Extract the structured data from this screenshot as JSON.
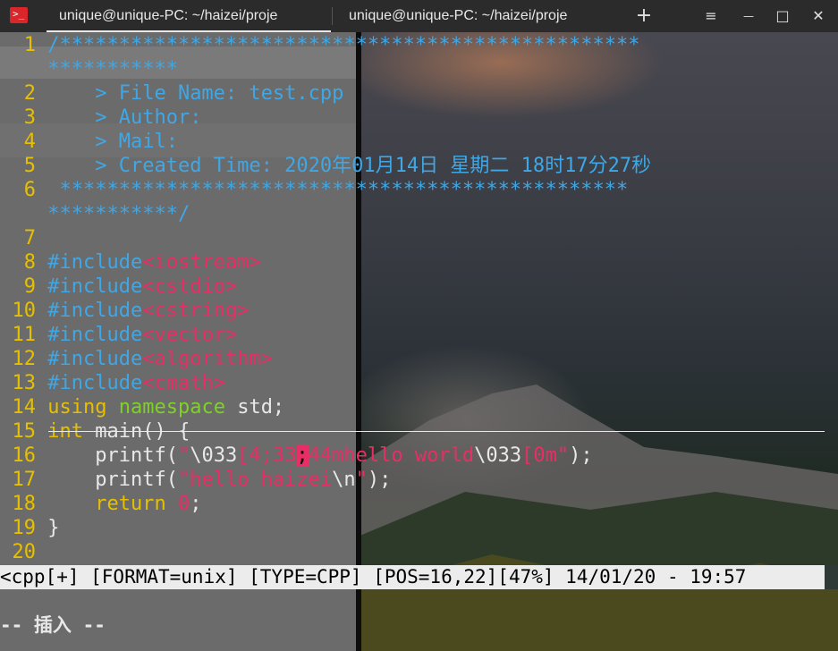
{
  "window": {
    "tabs": [
      {
        "label": "unique@unique-PC: ~/haizei/proje",
        "active": true
      },
      {
        "label": "unique@unique-PC: ~/haizei/proje",
        "active": false
      }
    ],
    "new_tab_glyph": "+",
    "menu_glyph": "≡",
    "minimize_glyph": "—",
    "maximize_glyph": "□",
    "close_glyph": "✕"
  },
  "editor": {
    "lines": [
      {
        "n": "1",
        "parts": [
          [
            "cmt",
            "/*************************************************"
          ]
        ]
      },
      {
        "n": "",
        "parts": [
          [
            "cmt",
            "***********"
          ]
        ]
      },
      {
        "n": "2",
        "parts": [
          [
            "cmt",
            "    > File Name: test.cpp"
          ]
        ]
      },
      {
        "n": "3",
        "parts": [
          [
            "cmt",
            "    > Author:"
          ]
        ]
      },
      {
        "n": "4",
        "parts": [
          [
            "cmt",
            "    > Mail:"
          ]
        ]
      },
      {
        "n": "5",
        "parts": [
          [
            "cmt",
            "    > Created Time: 2020年01月14日 星期二 18时17分27秒"
          ]
        ]
      },
      {
        "n": "6",
        "parts": [
          [
            "cmt",
            " ************************************************"
          ]
        ]
      },
      {
        "n": "",
        "parts": [
          [
            "cmt",
            "***********/"
          ]
        ]
      },
      {
        "n": "7",
        "parts": []
      },
      {
        "n": "8",
        "parts": [
          [
            "pp",
            "#include"
          ],
          [
            "hdr",
            "<iostream>"
          ]
        ]
      },
      {
        "n": "9",
        "parts": [
          [
            "pp",
            "#include"
          ],
          [
            "hdr",
            "<cstdio>"
          ]
        ]
      },
      {
        "n": "10",
        "parts": [
          [
            "pp",
            "#include"
          ],
          [
            "hdr",
            "<cstring>"
          ]
        ]
      },
      {
        "n": "11",
        "parts": [
          [
            "pp",
            "#include"
          ],
          [
            "hdr",
            "<vector>"
          ]
        ]
      },
      {
        "n": "12",
        "parts": [
          [
            "pp",
            "#include"
          ],
          [
            "hdr",
            "<algorithm>"
          ]
        ]
      },
      {
        "n": "13",
        "parts": [
          [
            "pp",
            "#include"
          ],
          [
            "hdr",
            "<cmath>"
          ]
        ]
      },
      {
        "n": "14",
        "parts": [
          [
            "kw2",
            "using"
          ],
          [
            "txt",
            " "
          ],
          [
            "kw",
            "namespace"
          ],
          [
            "txt",
            " std;"
          ]
        ]
      },
      {
        "n": "15",
        "parts": [
          [
            "kw2",
            "int"
          ],
          [
            "txt",
            " main() {"
          ]
        ]
      },
      {
        "n": "16",
        "parts": [
          [
            "txt",
            "    printf("
          ],
          [
            "str",
            "\""
          ],
          [
            "esc",
            "\\033"
          ],
          [
            "str",
            "[4;33"
          ],
          [
            "cursor",
            ";"
          ],
          [
            "str",
            "44mhello world"
          ],
          [
            "esc",
            "\\033"
          ],
          [
            "str",
            "[0m\""
          ],
          [
            "txt",
            ");"
          ]
        ]
      },
      {
        "n": "17",
        "parts": [
          [
            "txt",
            "    printf("
          ],
          [
            "str",
            "\"hello haizei"
          ],
          [
            "esc",
            "\\n"
          ],
          [
            "str",
            "\""
          ],
          [
            "txt",
            ");"
          ]
        ]
      },
      {
        "n": "18",
        "parts": [
          [
            "kw2",
            "    return"
          ],
          [
            "txt",
            " "
          ],
          [
            "num",
            "0"
          ],
          [
            "txt",
            ";"
          ]
        ]
      },
      {
        "n": "19",
        "parts": [
          [
            "txt",
            "}"
          ]
        ]
      },
      {
        "n": "20",
        "parts": []
      }
    ]
  },
  "statusline": "<cpp[+] [FORMAT=unix] [TYPE=CPP] [POS=16,22][47%] 14/01/20 - 19:57",
  "modeline": "-- 插入 --",
  "colors": {
    "comment": "#3fa7e6",
    "preprocessor": "#3fa7e6",
    "header": "#e82e64",
    "keyword": "#7ed321",
    "type": "#e6c000",
    "line_number": "#e6c000"
  }
}
